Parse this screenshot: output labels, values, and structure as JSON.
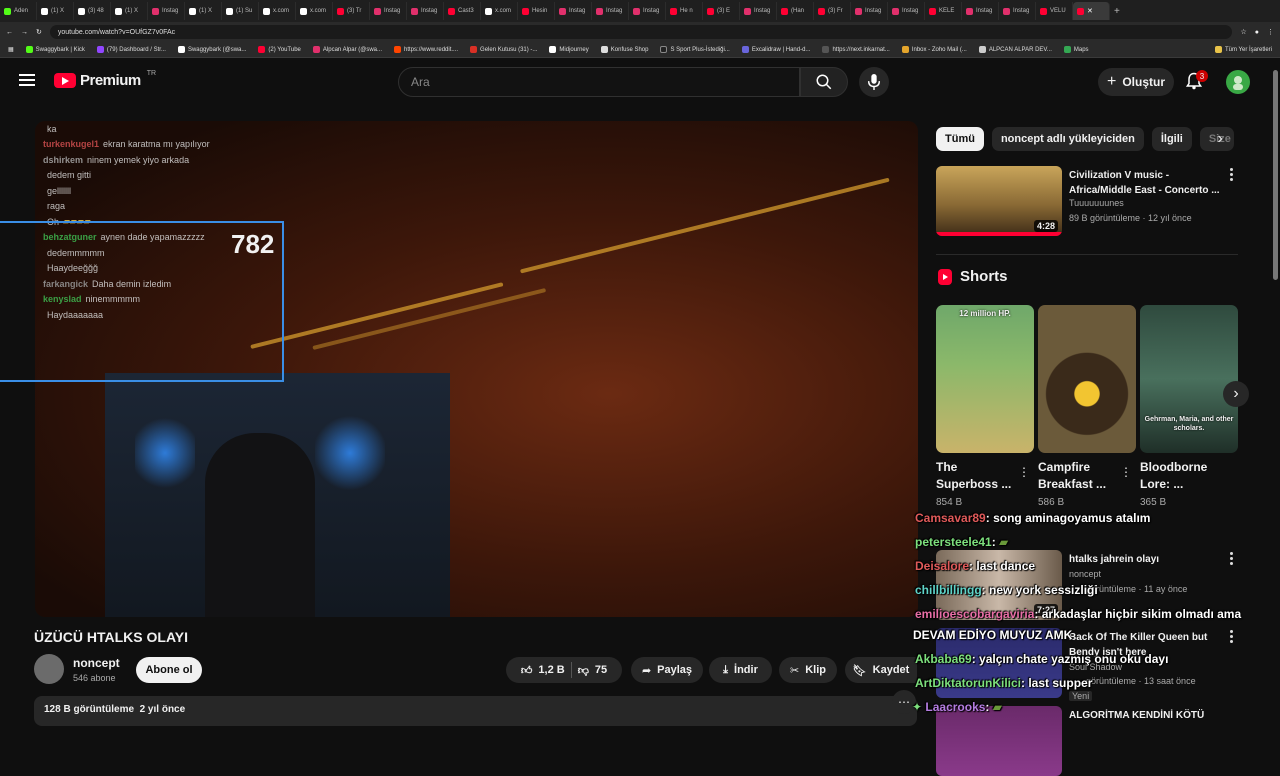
{
  "browser": {
    "tabs": [
      "Aden",
      "(1) X",
      "(3) 48",
      "(1) X",
      "Instag",
      "(1) X",
      "(1) Su",
      "x.com",
      "x.com",
      "(3) Tr",
      "Instag",
      "Instag",
      "Cast3",
      "x.com",
      "Hesin",
      "Instag",
      "Instag",
      "Instag",
      "He n",
      "(3) E",
      "Instag",
      "(Han",
      "(3) Fr",
      "Instag",
      "Instag",
      "KELE",
      "Instag",
      "Instag",
      "VELU"
    ],
    "url": "youtube.com/watch?v=OUfGZ7v0FAc",
    "bookmarks": [
      "Swaggybark | Kick",
      "(79) Dashboard / Str...",
      "Swaggybark (@swa...",
      "(2) YouTube",
      "Alpcan Alpar (@swa...",
      "https://www.reddit....",
      "Gelen Kutusu (31) -...",
      "Midjourney",
      "Konfuse Shop",
      "S Sport Plus-İstediği...",
      "Excalidraw | Hand-d...",
      "https://next.inkarnat...",
      "Inbox - Zoho Mail (...",
      "ALPCAN ALPAR DEV...",
      "Maps"
    ],
    "all_bookmarks": "Tüm Yer İşaretleri"
  },
  "header": {
    "logo": "Premium",
    "region": "TR",
    "search_placeholder": "Ara",
    "create_label": "Oluştur",
    "notifications": "3"
  },
  "player": {
    "counter": "782",
    "chat": [
      {
        "user": "",
        "msg": "ka"
      },
      {
        "user": "turkenkugel1",
        "msg": "ekran karatma mı yapılıyor"
      },
      {
        "user": "dshirkem",
        "msg": "ninem yemek yiyo arkada"
      },
      {
        "user": "",
        "msg": "dedem gitti"
      },
      {
        "user": "",
        "msg": "gelllllll"
      },
      {
        "user": "",
        "msg": "raga"
      },
      {
        "user": "",
        "msg": "Oh"
      },
      {
        "user": "behzatguner",
        "msg": "aynen dade yapamazzzzz"
      },
      {
        "user": "",
        "msg": "dedemmmmm"
      },
      {
        "user": "",
        "msg": "Haaydeeğğğ"
      },
      {
        "user": "farkangick",
        "msg": "Daha demin izledim"
      },
      {
        "user": "kenyslad",
        "msg": "ninemmmmm"
      },
      {
        "user": "",
        "msg": "Haydaaaaaaa"
      }
    ]
  },
  "video": {
    "title": "ÜZÜCÜ HTALKS OLAYI",
    "channel": "noncept",
    "subs": "546 abone",
    "subscribe": "Abone ol",
    "likes": "1,2 B",
    "dislikes": "75",
    "share": "Paylaş",
    "download": "İndir",
    "clip": "Klip",
    "save": "Kaydet",
    "views": "128 B görüntüleme",
    "age": "2 yıl önce"
  },
  "sidebar": {
    "chips": [
      "Tümü",
      "noncept adlı yükleyiciden",
      "İlgili",
      "Size"
    ],
    "rec1": {
      "title": "Civilization V music - Africa/Middle East - Concerto ...",
      "channel": "Tuuuuuuunes",
      "meta": "89 B görüntüleme · 12 yıl önce",
      "duration": "4:28"
    },
    "shorts_title": "Shorts",
    "shorts": [
      {
        "title": "The Superboss ...",
        "views": "854 B",
        "caption": "12 million HP."
      },
      {
        "title": "Campfire Breakfast ...",
        "views": "586 B",
        "caption": ""
      },
      {
        "title": "Bloodborne Lore: ...",
        "views": "365 B",
        "caption": "Gehrman, Maria, and other scholars."
      }
    ],
    "rec2": {
      "title": "htalks jahrein olayı",
      "channel": "noncept",
      "meta": "görüntüleme · 11 ay önce",
      "duration": "7:27"
    },
    "rec3": {
      "title": "Back Of The Killer Queen but Bendy isn't here",
      "channel": "Soul Shadow",
      "meta": "görüntüleme · 13 saat önce",
      "badge": "Yeni"
    },
    "rec4": {
      "title": "ALGORİTMA KENDİNİ KÖTÜ"
    }
  },
  "overlay_chat": [
    {
      "user": "Camsavar89",
      "msg": ": song aminagoyamus atalım",
      "color": "#e05a5a"
    },
    {
      "user": "petersteele41",
      "msg": ":",
      "color": "#7de07d"
    },
    {
      "user": "Deisalore",
      "msg": ": last dance",
      "color": "#e05a5a"
    },
    {
      "user": "chillbillingg",
      "msg": ": new york sessizliği",
      "color": "#5fd4c9"
    },
    {
      "user": "emilioescobargaviria",
      "msg": ": arkadaşlar hiçbir sikim olmadı ama",
      "color": "#e86ea6"
    },
    {
      "user": "",
      "msg": "DEVAM EDİYO MUYUZ AMK",
      "color": "#fff"
    },
    {
      "user": "Akbaba69",
      "msg": ": yalçın chate yazmış onu oku dayı",
      "color": "#7de07d"
    },
    {
      "user": "ArtDiktatorunKilici",
      "msg": ": last supper",
      "color": "#7de07d"
    },
    {
      "user": "Laacrooks",
      "msg": ":",
      "color": "#b47de0"
    }
  ]
}
